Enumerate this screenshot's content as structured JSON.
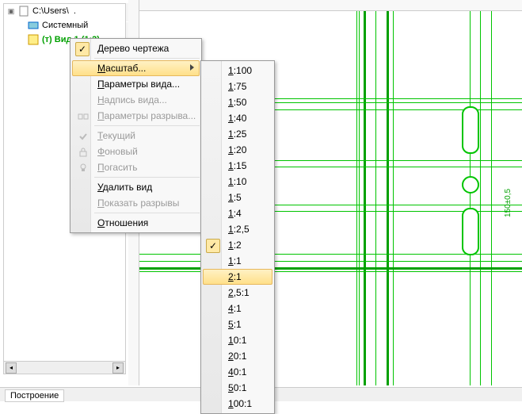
{
  "path": "C:\\Users\\",
  "tree": {
    "root_label": "Системный",
    "view_label": "(т) Вид 1 (1:2)"
  },
  "toolbar_icons": [
    "flag-icon",
    "tag-icon",
    "bulb-icon",
    "search-icon"
  ],
  "toolbar2_icons": [
    "doc-icon",
    "page-icon",
    "layers-icon"
  ],
  "context_menu": {
    "tree_item": "Дерево чертежа",
    "scale_item": "Масштаб...",
    "view_params": "Параметры вида...",
    "view_label": "Надпись вида...",
    "break_params": "Параметры разрыва...",
    "current": "Текущий",
    "background": "Фоновый",
    "extinguish": "Погасить",
    "delete_view": "Удалить вид",
    "show_breaks": "Показать разрывы",
    "relations": "Отношения"
  },
  "scale_menu": {
    "selected": "1:2",
    "hover": "2:1",
    "items": [
      "1:100",
      "1:75",
      "1:50",
      "1:40",
      "1:25",
      "1:20",
      "1:15",
      "1:10",
      "1:5",
      "1:4",
      "1:2,5",
      "1:2",
      "1:1",
      "2:1",
      "2,5:1",
      "4:1",
      "5:1",
      "10:1",
      "20:1",
      "40:1",
      "50:1",
      "100:1"
    ]
  },
  "dimension_text": "150±0,5",
  "status_tab": "Построение"
}
